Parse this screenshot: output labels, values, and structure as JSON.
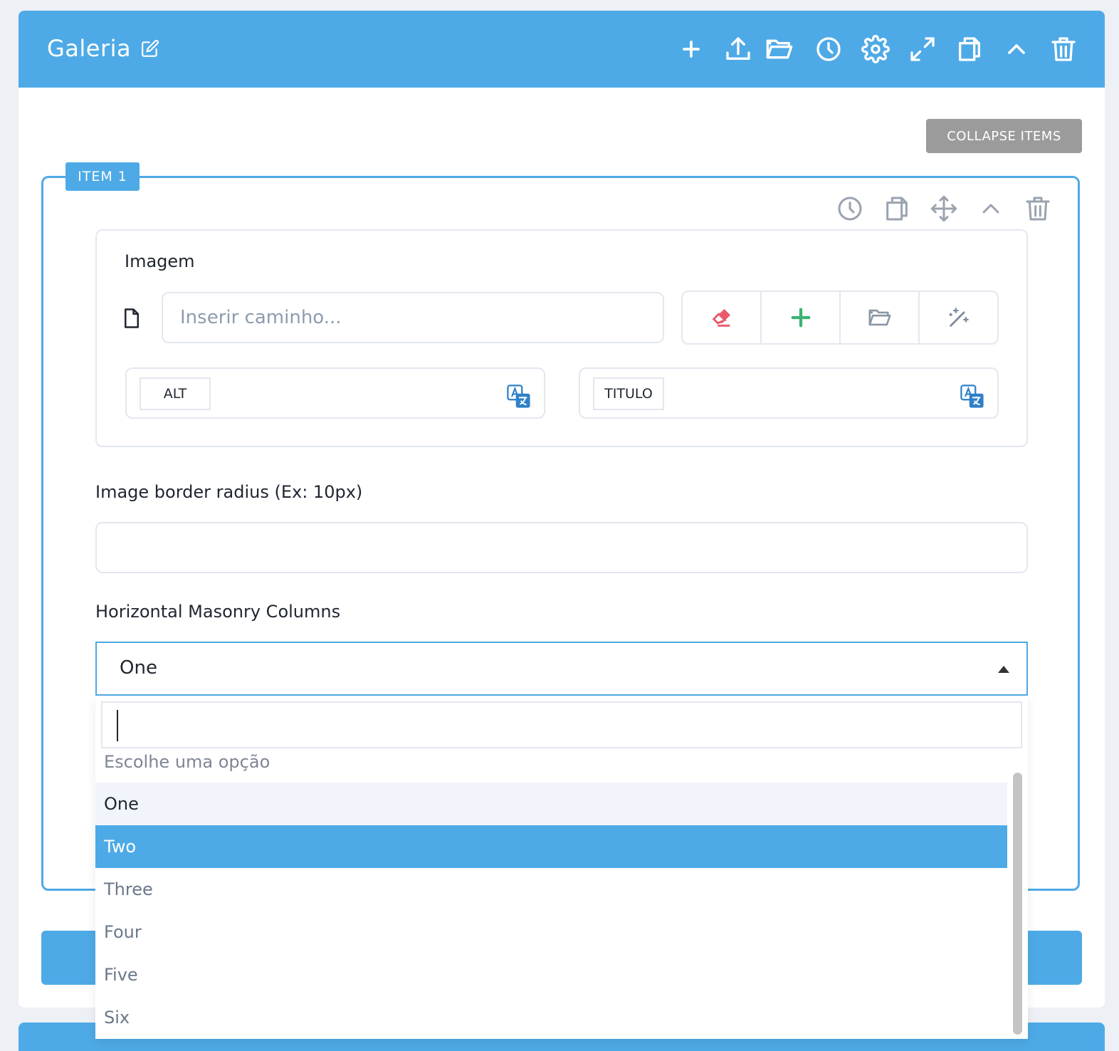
{
  "header": {
    "title": "Galeria",
    "icons": [
      "add-icon",
      "upload-icon",
      "folder-open-icon",
      "history-icon",
      "gear-icon",
      "expand-icon",
      "copy-icon",
      "chevron-up-icon",
      "trash-icon"
    ]
  },
  "collapse_button": "COLLAPSE ITEMS",
  "item": {
    "badge": "ITEM  1",
    "icons": [
      "history-icon",
      "copy-icon",
      "move-icon",
      "chevron-up-icon",
      "trash-icon"
    ]
  },
  "image": {
    "label": "Imagem",
    "path_placeholder": "Inserir caminho...",
    "path_value": "",
    "actions": [
      "eraser-icon",
      "plus-icon",
      "folder-open-icon",
      "magic-wand-icon"
    ],
    "alt_label": "ALT",
    "title_label": "TITULO"
  },
  "radius": {
    "label": "Image border radius (Ex: 10px)",
    "value": ""
  },
  "masonry": {
    "label": "Horizontal Masonry Columns",
    "selected": "One",
    "search_value": "",
    "placeholder_option": "Escolhe uma opção",
    "options": [
      "One",
      "Two",
      "Three",
      "Four",
      "Five",
      "Six"
    ],
    "highlighted": "Two"
  },
  "colors": {
    "accent": "#4eaae6",
    "collapse_button": "#9b9b9b",
    "eraser": "#e85a6b",
    "plus": "#3cb371"
  }
}
